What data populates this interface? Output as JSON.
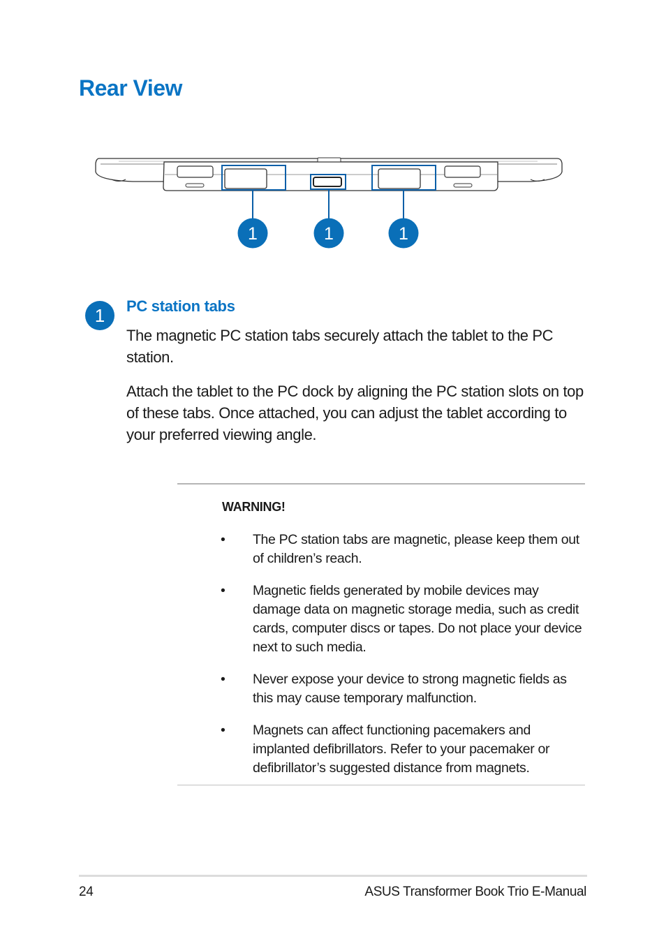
{
  "page": {
    "title": "Rear View",
    "diagram": {
      "callouts": [
        "1",
        "1",
        "1"
      ],
      "highlight_color": "#0a5fa8",
      "badge_color": "#0a6fb8"
    },
    "section": {
      "badge": "1",
      "heading": "PC station tabs",
      "paragraphs": [
        "The magnetic PC station tabs securely attach the tablet to the PC station.",
        "Attach the tablet to the PC dock by aligning the PC station slots on top of these tabs. Once attached, you can adjust the tablet according to your preferred viewing angle."
      ]
    },
    "warning": {
      "title": "WARNING!",
      "bullet": "•",
      "items": [
        "The PC station tabs are magnetic, please keep them out of children’s reach.",
        "Magnetic fields generated by mobile devices may damage data on magnetic storage media, such as credit cards, computer discs or tapes. Do not place your device next to such media.",
        "Never expose your device to strong magnetic fields as this may cause temporary malfunction.",
        "Magnets can affect functioning pacemakers and implanted defibrillators. Refer to your pacemaker or defibrillator’s suggested distance from magnets."
      ]
    },
    "footer": {
      "page_number": "24",
      "manual_name": "ASUS Transformer Book Trio E-Manual"
    },
    "colors": {
      "heading_blue": "#0a74c4",
      "text": "#1a1a1a"
    }
  }
}
